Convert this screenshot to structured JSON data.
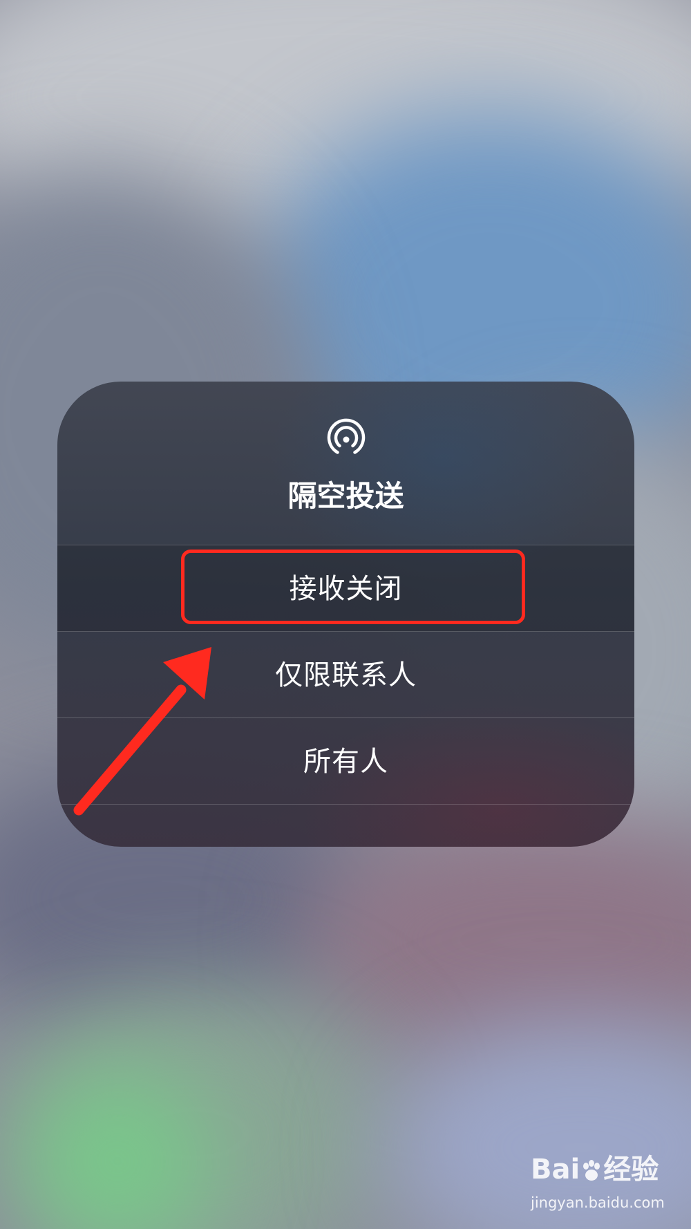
{
  "airdrop_menu": {
    "icon": "airdrop-icon",
    "title": "隔空投送",
    "options": [
      {
        "label": "接收关闭",
        "highlighted": true
      },
      {
        "label": "仅限联系人",
        "highlighted": false
      },
      {
        "label": "所有人",
        "highlighted": false
      }
    ]
  },
  "annotation": {
    "color": "#ff2a1f",
    "highlight_target": "接收关闭"
  },
  "watermark": {
    "logo_prefix": "Bai",
    "logo_suffix": "经验",
    "url": "jingyan.baidu.com"
  }
}
